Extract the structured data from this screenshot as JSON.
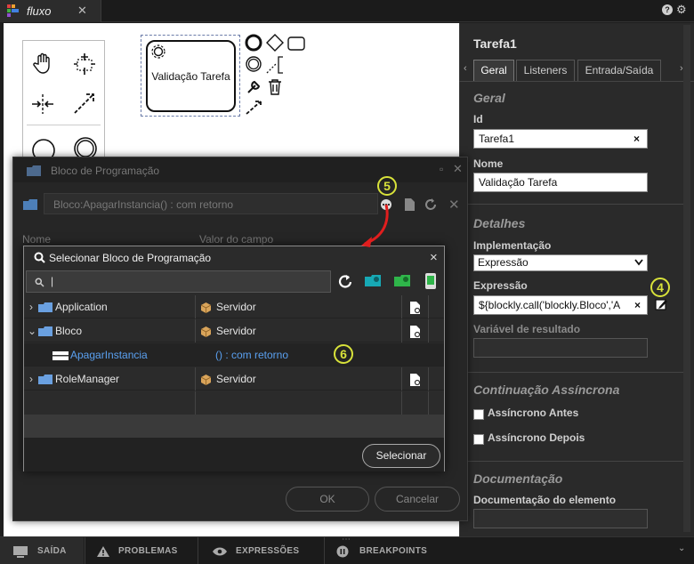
{
  "topbar": {
    "tab_title": "fluxo",
    "tab_close": "✕",
    "help": "?",
    "settings": "⚙"
  },
  "canvas": {
    "task_label": "Validação Tarefa"
  },
  "props": {
    "title": "Tarefa1",
    "tabs": [
      "Geral",
      "Listeners",
      "Entrada/Saída"
    ],
    "section_general": "Geral",
    "id_label": "Id",
    "id_value": "Tarefa1",
    "name_label": "Nome",
    "name_value": "Validação Tarefa",
    "section_details": "Detalhes",
    "impl_label": "Implementação",
    "impl_value": "Expressão",
    "expr_label": "Expressão",
    "expr_value": "${blockly.call('blockly.Bloco','A",
    "result_label": "Variável de resultado",
    "section_async": "Continuação Assíncrona",
    "async_before": "Assíncrono Antes",
    "async_after": "Assíncrono Depois",
    "section_doc": "Documentação",
    "doc_label": "Documentação do elemento"
  },
  "bg_dialog": {
    "title": "Bloco de Programação",
    "block_value": "Bloco:ApagarInstancia() : com retorno",
    "col_name": "Nome",
    "col_value": "Valor do campo",
    "ok": "OK",
    "cancel": "Cancelar"
  },
  "fg_dialog": {
    "title": "Selecionar Bloco de Programação",
    "close": "×",
    "search_value": "|",
    "rows": [
      {
        "name": "Application",
        "type": "Servidor",
        "expandable": true,
        "expanded": false
      },
      {
        "name": "Bloco",
        "type": "Servidor",
        "expandable": true,
        "expanded": true
      },
      {
        "name": "ApagarInstancia",
        "type": "() : com retorno",
        "expandable": false,
        "child": true
      },
      {
        "name": "RoleManager",
        "type": "Servidor",
        "expandable": true,
        "expanded": false
      }
    ],
    "select_button": "Selecionar"
  },
  "badges": {
    "four": "4",
    "five": "5",
    "six": "6"
  },
  "bottombar": {
    "items": [
      "SAÍDA",
      "PROBLEMAS",
      "EXPRESSÕES",
      "BREAKPOINTS"
    ]
  },
  "colors": {
    "accent_yellow": "#d8e23a",
    "folder_blue": "#6aa0e0",
    "link_blue": "#5aa0f0",
    "arrow_red": "#e01e1e"
  }
}
